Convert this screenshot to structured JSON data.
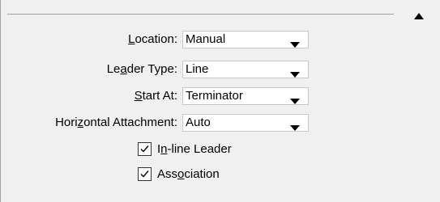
{
  "panel": {
    "collapse_icon": "triangle-up-icon"
  },
  "fields": [
    {
      "label_pre": "",
      "label_key": "L",
      "label_post": "ocation:",
      "value": "Manual"
    },
    {
      "label_pre": "Le",
      "label_key": "a",
      "label_post": "der Type:",
      "value": "Line"
    },
    {
      "label_pre": "",
      "label_key": "S",
      "label_post": "tart At:",
      "value": "Terminator"
    },
    {
      "label_pre": "Hori",
      "label_key": "z",
      "label_post": "ontal Attachment:",
      "value": "Auto"
    }
  ],
  "checkboxes": [
    {
      "label_pre": "I",
      "label_key": "n",
      "label_post": "-line Leader",
      "checked": true
    },
    {
      "label_pre": "Ass",
      "label_key": "o",
      "label_post": "ciation",
      "checked": true
    }
  ],
  "icons": {
    "dropdown": "dropdown-arrow-icon",
    "check": "checkmark-icon"
  }
}
